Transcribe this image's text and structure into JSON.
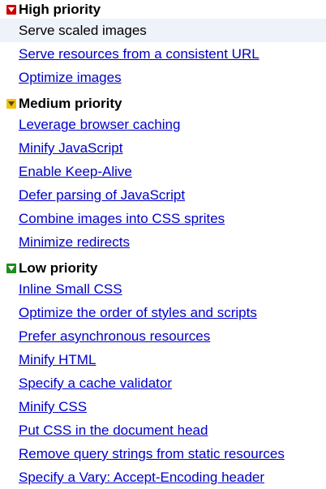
{
  "groups": [
    {
      "title": "High priority",
      "color": "#cc0000",
      "icon": "collapse-toggle-icon",
      "items": [
        {
          "label": "Serve scaled images",
          "selected": true
        },
        {
          "label": "Serve resources from a consistent URL"
        },
        {
          "label": "Optimize images"
        }
      ]
    },
    {
      "title": "Medium priority",
      "color": "#f2c200",
      "icon": "collapse-toggle-icon",
      "items": [
        {
          "label": "Leverage browser caching"
        },
        {
          "label": "Minify JavaScript"
        },
        {
          "label": "Enable Keep-Alive"
        },
        {
          "label": "Defer parsing of JavaScript"
        },
        {
          "label": "Combine images into CSS sprites"
        },
        {
          "label": "Minimize redirects"
        }
      ]
    },
    {
      "title": "Low priority",
      "color": "#1e8c1e",
      "icon": "collapse-toggle-icon",
      "items": [
        {
          "label": "Inline Small CSS"
        },
        {
          "label": "Optimize the order of styles and scripts"
        },
        {
          "label": "Prefer asynchronous resources"
        },
        {
          "label": "Minify HTML"
        },
        {
          "label": "Specify a cache validator"
        },
        {
          "label": "Minify CSS"
        },
        {
          "label": "Put CSS in the document head"
        },
        {
          "label": "Remove query strings from static resources"
        },
        {
          "label": "Specify a Vary: Accept-Encoding header"
        }
      ]
    }
  ],
  "colors": {
    "link": "#0000cc",
    "selected_bg": "#eef2f9"
  }
}
